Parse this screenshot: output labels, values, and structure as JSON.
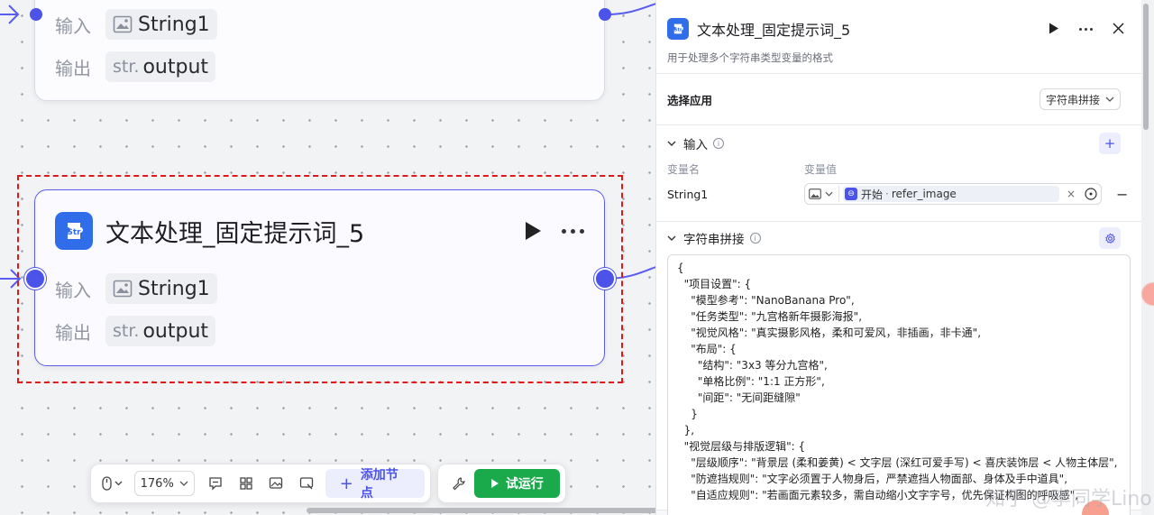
{
  "nodes": {
    "top": {
      "input_label": "输入",
      "input_var": "String1",
      "output_label": "输出",
      "output_type": "str.",
      "output_var": "output"
    },
    "main": {
      "logo_text": "Str",
      "title": "文本处理_固定提示词_5",
      "input_label": "输入",
      "input_var": "String1",
      "output_label": "输出",
      "output_type": "str.",
      "output_var": "output"
    }
  },
  "toolbar": {
    "zoom": "176%",
    "add_node": "添加节点",
    "run": "试运行"
  },
  "panel": {
    "logo_text": "Str",
    "title": "文本处理_固定提示词_5",
    "description": "用于处理多个字符串类型变量的格式",
    "app_label": "选择应用",
    "app_value": "字符串拼接",
    "input_section": {
      "title": "输入",
      "col_name": "变量名",
      "col_value": "变量值",
      "var_name": "String1",
      "ref_source": "开始",
      "ref_var": "refer_image"
    },
    "concat_section": {
      "title": "字符串拼接",
      "code_lines": [
        "{",
        "  \"项目设置\": {",
        "    \"模型参考\": \"NanoBanana Pro\",",
        "    \"任务类型\": \"九宫格新年摄影海报\",",
        "    \"视觉风格\": \"真实摄影风格，柔和可爱风，非插画，非卡通\",",
        "    \"布局\": {",
        "      \"结构\": \"3x3 等分九宫格\",",
        "      \"单格比例\": \"1:1 正方形\",",
        "      \"间距\": \"无间距缝隙\"",
        "    }",
        "  },",
        "  \"视觉层级与排版逻辑\": {",
        "    \"层级顺序\": \"背景层 (柔和姜黄) < 文字层 (深红可爱手写) < 喜庆装饰层 < 人物主体层\",",
        "    \"防遮挡规则\": \"文字必须置于人物身后，严禁遮挡人物面部、身体及手中道具\",",
        "    \"自适应规则\": \"若画面元素较多，需自动缩小文字字号，优先保证构图的呼吸感\","
      ]
    }
  },
  "watermark": "知乎 @李同学Lino"
}
